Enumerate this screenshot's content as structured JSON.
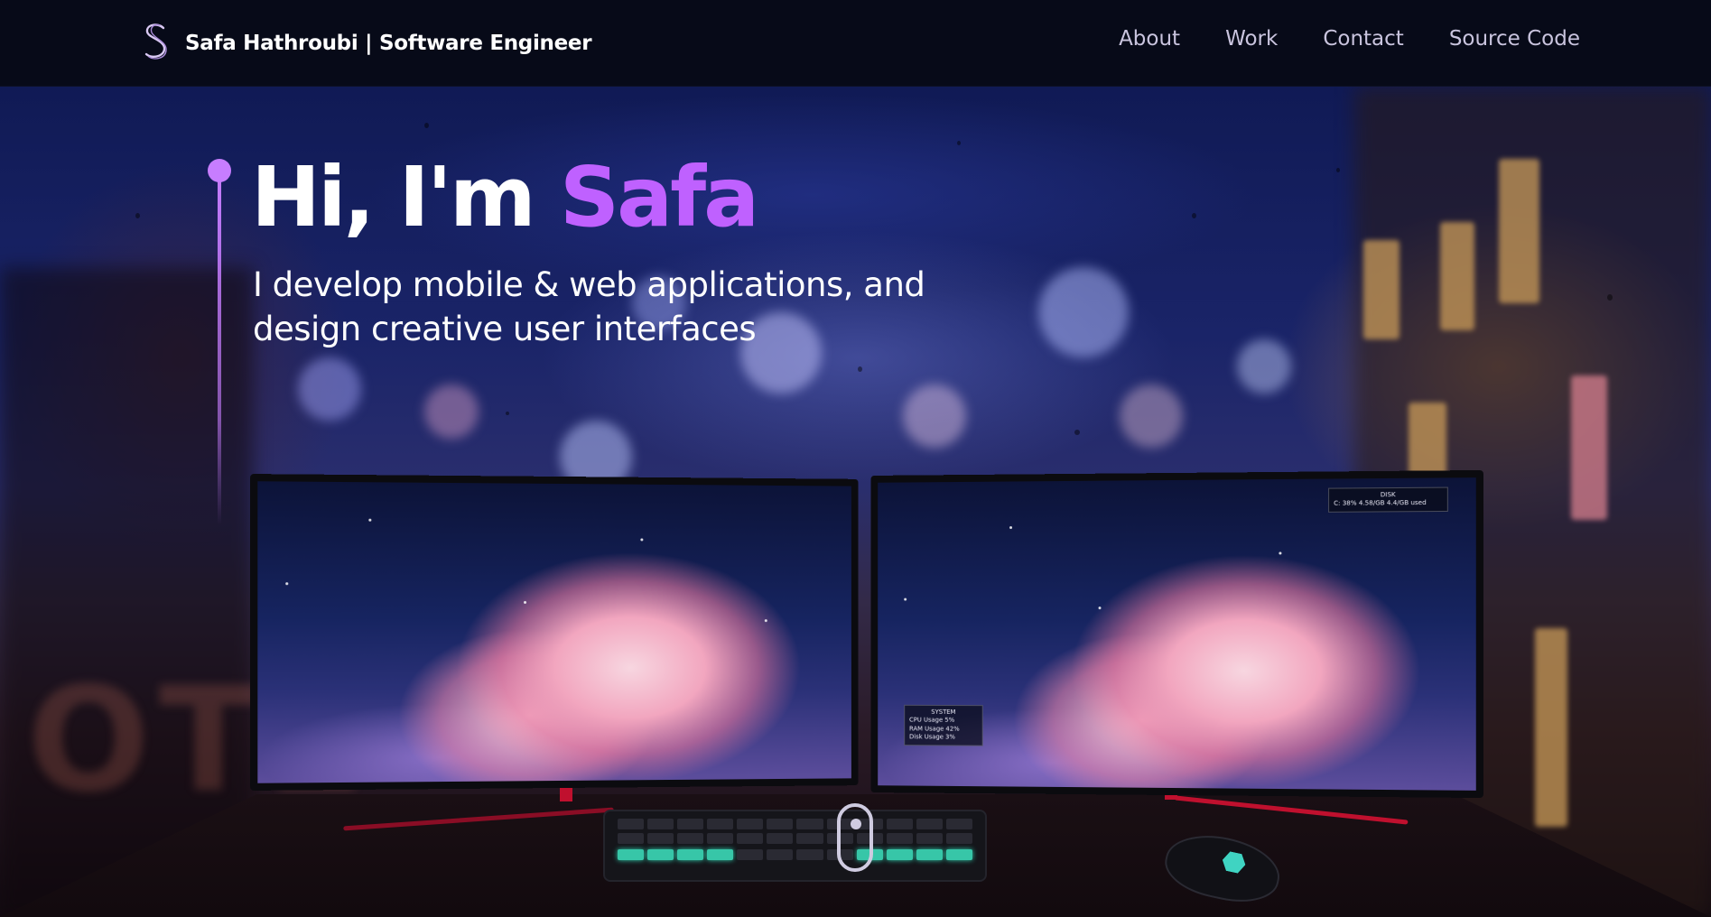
{
  "header": {
    "brand_name": "Safa Hathroubi | Software Engineer",
    "logo_icon": "s-monogram-icon",
    "nav": [
      {
        "label": "About"
      },
      {
        "label": "Work"
      },
      {
        "label": "Contact"
      },
      {
        "label": "Source Code"
      }
    ]
  },
  "hero": {
    "greeting": "Hi, I'm ",
    "name": "Safa",
    "subtitle": "I develop mobile & web applications, and design creative user interfaces",
    "scroll_icon": "mouse-scroll-icon"
  },
  "scene": {
    "right_screen_widget_title": "DISK",
    "right_screen_widget_text": "C:    38% 4.58/GB  4.4/GB used",
    "system_widget_title": "SYSTEM",
    "system_widget_lines": [
      "CPU Usage    5%",
      "RAM Usage   42%",
      "Disk Usage   3%"
    ]
  },
  "colors": {
    "accent": "#bf61ff",
    "nav_text": "#c9c4de",
    "header_bg": "#070a18"
  }
}
